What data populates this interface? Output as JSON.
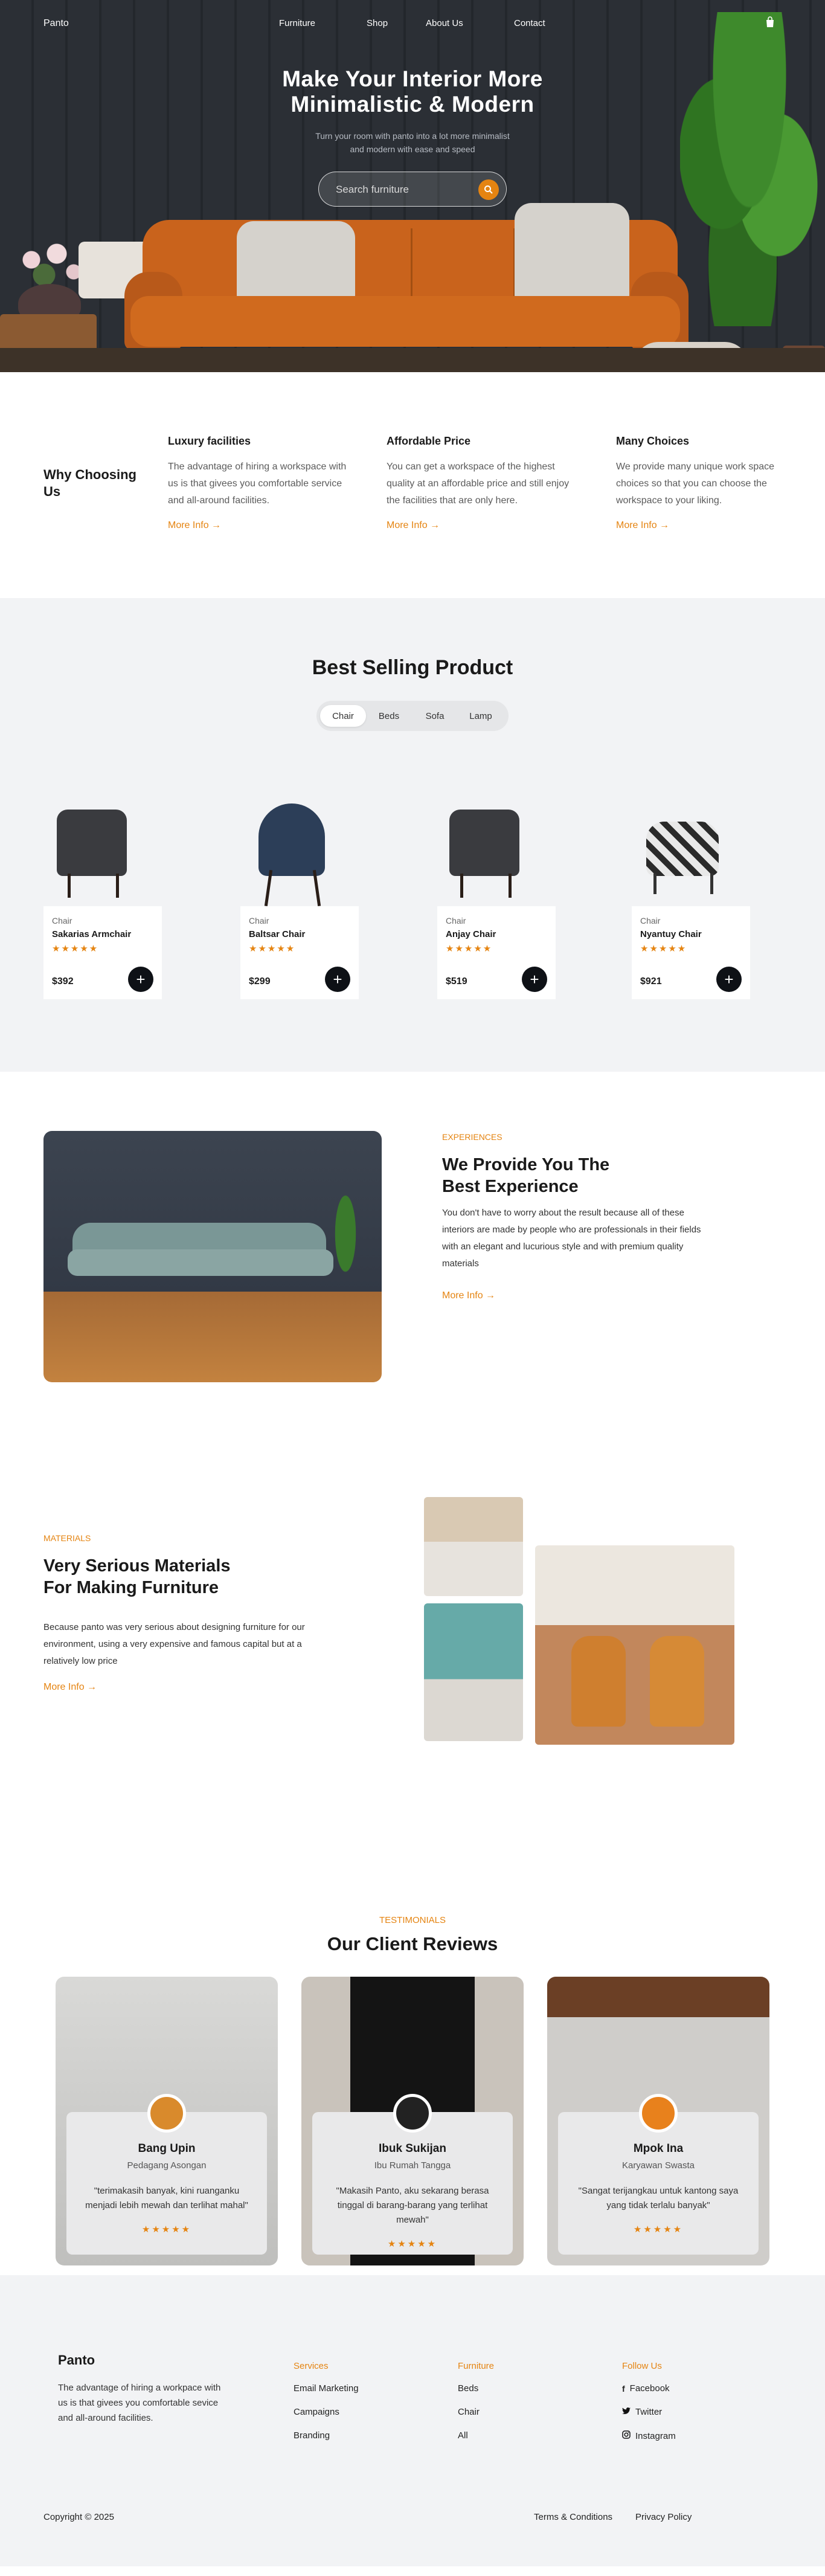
{
  "nav": {
    "logo": "Panto",
    "links": [
      "Furniture",
      "Shop",
      "About Us",
      "Contact"
    ],
    "cart_icon": "shopping-bag-icon"
  },
  "hero": {
    "title_line1": "Make Your Interior More",
    "title_line2": "Minimalistic & Modern",
    "subtitle_line1": "Turn your room with panto into a lot more minimalist",
    "subtitle_line2": "and modern with ease and speed",
    "search_placeholder": "Search furniture",
    "search_icon": "search-icon"
  },
  "why": {
    "title": "Why Choosing Us",
    "cols": [
      {
        "title": "Luxury facilities",
        "text": "The advantage of hiring a workspace with us is that givees you comfortable service and all-around facilities.",
        "more": "More Info →"
      },
      {
        "title": "Affordable Price",
        "text": "You can get a workspace of the highest quality at an affordable price and still enjoy the facilities that are only here.",
        "more": "More Info →"
      },
      {
        "title": "Many Choices",
        "text": "We provide many unique work space choices so that you can choose the workspace to your liking.",
        "more": "More Info →"
      }
    ]
  },
  "best": {
    "title": "Best Selling Product",
    "tabs": [
      "Chair",
      "Beds",
      "Sofa",
      "Lamp"
    ],
    "active_tab": "Chair",
    "products": [
      {
        "category": "Chair",
        "name": "Sakarias Armchair",
        "stars": "★★★★★",
        "price": "$392"
      },
      {
        "category": "Chair",
        "name": "Baltsar Chair",
        "stars": "★★★★★",
        "price": "$299"
      },
      {
        "category": "Chair",
        "name": "Anjay Chair",
        "stars": "★★★★★",
        "price": "$519"
      },
      {
        "category": "Chair",
        "name": "Nyantuy Chair",
        "stars": "★★★★★",
        "price": "$921"
      }
    ],
    "add_symbol": "+"
  },
  "experience": {
    "label": "EXPERIENCES",
    "title": "We Provide You The Best Experience",
    "text": "You don't have to worry about the result because all of these interiors are made by people who are professionals in their fields with an elegant and lucurious style and with premium quality materials",
    "more": "More Info →"
  },
  "materials": {
    "label": "MATERIALS",
    "title": "Very Serious Materials For Making Furniture",
    "text": "Because panto was very serious about designing furniture for our environment, using a very expensive and famous capital but at a relatively low price",
    "more": "More Info →"
  },
  "testimonials": {
    "label": "TESTIMONIALS",
    "title": "Our Client Reviews",
    "reviews": [
      {
        "name": "Bang Upin",
        "role": "Pedagang Asongan",
        "quote": "\"terimakasih banyak, kini ruanganku menjadi lebih mewah dan terlihat mahal\"",
        "stars": "★★★★★"
      },
      {
        "name": "Ibuk Sukijan",
        "role": "Ibu Rumah Tangga",
        "quote": "\"Makasih Panto, aku sekarang berasa tinggal di barang-barang yang terlihat mewah\"",
        "stars": "★★★★★"
      },
      {
        "name": "Mpok Ina",
        "role": "Karyawan Swasta",
        "quote": "\"Sangat terijangkau untuk kantong saya yang tidak terlalu banyak\"",
        "stars": "★★★★★"
      }
    ]
  },
  "footer": {
    "brand": "Panto",
    "about": "The advantage of hiring a workpace with us is that givees you comfortable sevice and all-around facilities.",
    "services": {
      "heading": "Services",
      "items": [
        "Email Marketing",
        "Campaigns",
        "Branding"
      ]
    },
    "furniture": {
      "heading": "Furniture",
      "items": [
        "Beds",
        "Chair",
        "All"
      ]
    },
    "follow": {
      "heading": "Follow Us",
      "items": [
        "Facebook",
        "Twitter",
        "Instagram"
      ]
    },
    "copyright": "Copyright © 2025",
    "terms": "Terms & Conditions",
    "privacy": "Privacy Policy"
  },
  "colors": {
    "accent": "#e58411",
    "dark": "#0e1116",
    "section_bg": "#f2f3f5"
  }
}
